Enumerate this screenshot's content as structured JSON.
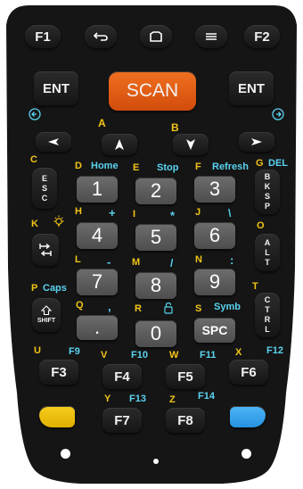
{
  "colors": {
    "body": "#151515",
    "key": "#222222",
    "digit_key": "#5c5c5c",
    "scan": "#e85a12",
    "alpha": "#f2c418",
    "cyan": "#5ad3f0",
    "yellow_soft": "#f5c518",
    "blue_soft": "#3aa8f0"
  },
  "top_row": {
    "f1": "F1",
    "f2": "F2",
    "back_icon": "back-arrow-icon",
    "home_icon": "home-icon",
    "menu_icon": "menu-icon"
  },
  "main_row": {
    "ent_left": "ENT",
    "scan": "SCAN",
    "ent_right": "ENT"
  },
  "nav": {
    "left_icon": "circle-left-icon",
    "right_icon": "circle-right-icon",
    "A": "A",
    "B": "B"
  },
  "side_left": {
    "C": "C",
    "esc": [
      "E",
      "S",
      "C"
    ],
    "K": "K",
    "bulb_icon": "bulb-icon",
    "tab_icon": "tab-icon",
    "L": "L",
    "P": "P",
    "caps": "Caps",
    "shift": "SHIFT",
    "U": "U",
    "f9": "F9"
  },
  "side_right": {
    "G": "G",
    "del": "DEL",
    "bksp": [
      "B",
      "K",
      "S",
      "P"
    ],
    "O": "O",
    "alt": [
      "A",
      "L",
      "T"
    ],
    "T": "T",
    "ctrl": [
      "C",
      "T",
      "R",
      "L"
    ],
    "X": "X",
    "f12": "F12"
  },
  "row1": {
    "D": "D",
    "home": "Home",
    "E": "E",
    "stop": "Stop",
    "F": "F",
    "refresh": "Refresh",
    "k1": "1",
    "k2": "2",
    "k3": "3"
  },
  "row2": {
    "H": "H",
    "plus": "+",
    "I": "I",
    "star": "*",
    "J": "J",
    "bslash": "\\",
    "k4": "4",
    "k5": "5",
    "k6": "6"
  },
  "row3": {
    "minus": "-",
    "M": "M",
    "slash": "/",
    "N": "N",
    "colon": ":",
    "k7": "7",
    "k8": "8",
    "k9": "9"
  },
  "row4": {
    "Q": "Q",
    "comma": ",",
    "R": "R",
    "lock_icon": "lock-icon",
    "S": "S",
    "symb": "Symb",
    "dot": ".",
    "k0": "0",
    "spc": "SPC"
  },
  "frow": {
    "V": "V",
    "f10": "F10",
    "W": "W",
    "f11": "F11",
    "f3": "F3",
    "f4": "F4",
    "f5": "F5",
    "f6": "F6"
  },
  "brow": {
    "Y": "Y",
    "f13": "F13",
    "Z": "Z",
    "f14": "F14",
    "f7": "F7",
    "f8": "F8"
  }
}
